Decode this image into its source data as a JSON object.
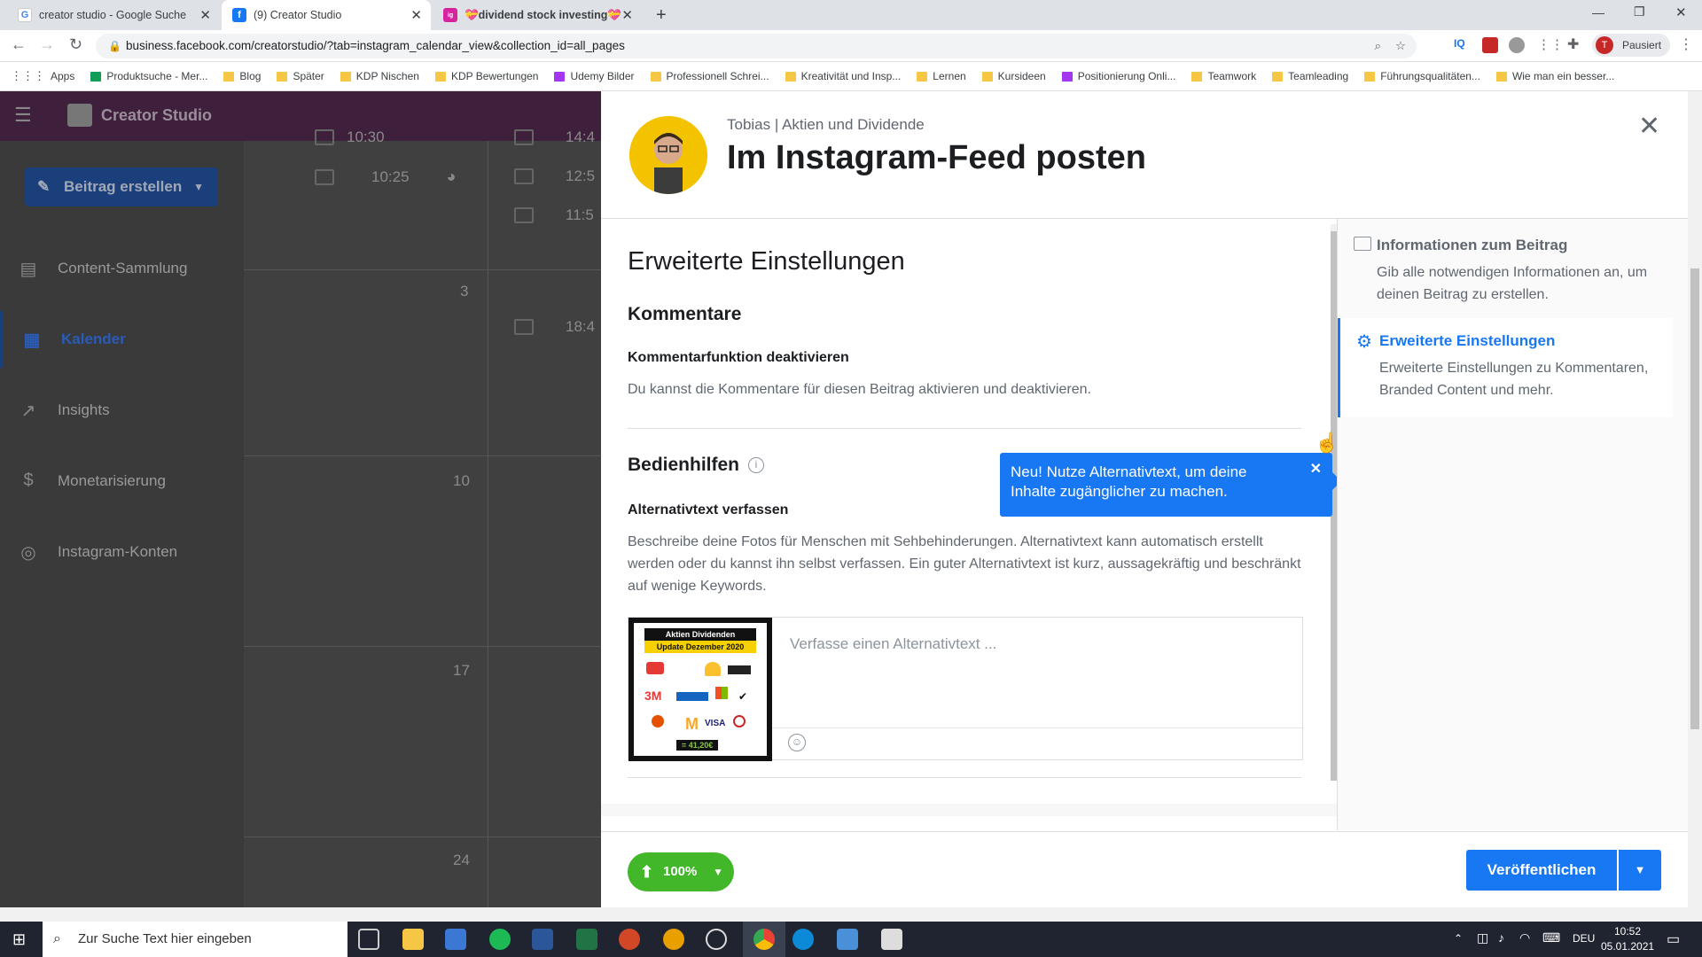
{
  "browser": {
    "tabs": [
      {
        "title": "creator studio - Google Suche",
        "favicon": "G"
      },
      {
        "title": "(9) Creator Studio",
        "favicon": "f"
      },
      {
        "title": "💝dividend stock investing💝",
        "favicon": "ig"
      }
    ],
    "url": "business.facebook.com/creatorstudio/?tab=instagram_calendar_view&collection_id=all_pages",
    "profile_label": "Pausiert",
    "profile_initial": "T",
    "bookmarks": [
      "Apps",
      "Produktsuche - Mer...",
      "Blog",
      "Später",
      "KDP Nischen",
      "KDP Bewertungen",
      "Udemy Bilder",
      "Professionell Schrei...",
      "Kreativität und Insp...",
      "Lernen",
      "Kursideen",
      "Positionierung Onli...",
      "Teamwork",
      "Teamleading",
      "Führungsqualitäten...",
      "Wie man ein besser..."
    ]
  },
  "creator_studio": {
    "title": "Creator Studio",
    "create_button": "Beitrag erstellen",
    "nav": [
      {
        "label": "Content-Sammlung",
        "icon": "collection-icon"
      },
      {
        "label": "Kalender",
        "icon": "calendar-icon"
      },
      {
        "label": "Insights",
        "icon": "insights-icon"
      },
      {
        "label": "Monetarisierung",
        "icon": "dollar-icon"
      },
      {
        "label": "Instagram-Konten",
        "icon": "account-icon"
      }
    ],
    "calendar": {
      "times_col1": [
        "10:30",
        "10:25"
      ],
      "times_col2": [
        "14:4",
        "12:5",
        "11:5",
        "18:4"
      ],
      "days": [
        "3",
        "10",
        "17",
        "24"
      ]
    }
  },
  "modal": {
    "account": "Tobias | Aktien und Dividende",
    "title": "Im Instagram-Feed posten",
    "section_title": "Erweiterte Einstellungen",
    "comments_heading": "Kommentare",
    "comments_sub": "Kommentarfunktion deaktivieren",
    "comments_desc": "Du kannst die Kommentare für diesen Beitrag aktivieren und deaktivieren.",
    "accessibility_heading": "Bedienhilfen",
    "alt_heading": "Alternativtext verfassen",
    "alt_desc": "Beschreibe deine Fotos für Menschen mit Sehbehinderungen. Alternativtext kann automatisch erstellt werden oder du kannst ihn selbst verfassen. Ein guter Alternativtext ist kurz, aussagekräftig und beschränkt auf wenige Keywords.",
    "alt_placeholder": "Verfasse einen Alternativtext ...",
    "thumb_title": "Aktien Dividenden",
    "thumb_sub": "Update Dezember 2020",
    "thumb_total": "= 41,20€",
    "tooltip": "Neu! Nutze Alternativtext, um deine Inhalte zugänglicher zu machen.",
    "right_panel": [
      {
        "title": "Informationen zum Beitrag",
        "desc": "Gib alle notwendigen Informationen an, um deinen Beitrag zu erstellen."
      },
      {
        "title": "Erweiterte Einstellungen",
        "desc": "Erweiterte Einstellungen zu Kommentaren, Branded Content und mehr."
      }
    ],
    "upload_progress": "100%",
    "publish_button": "Veröffentlichen"
  },
  "taskbar": {
    "search_placeholder": "Zur Suche Text hier eingeben",
    "language": "DEU",
    "time": "10:52",
    "date": "05.01.2021"
  },
  "colors": {
    "primary": "#1877f2",
    "success": "#42b72a",
    "cs_header": "#3e1f3c"
  }
}
